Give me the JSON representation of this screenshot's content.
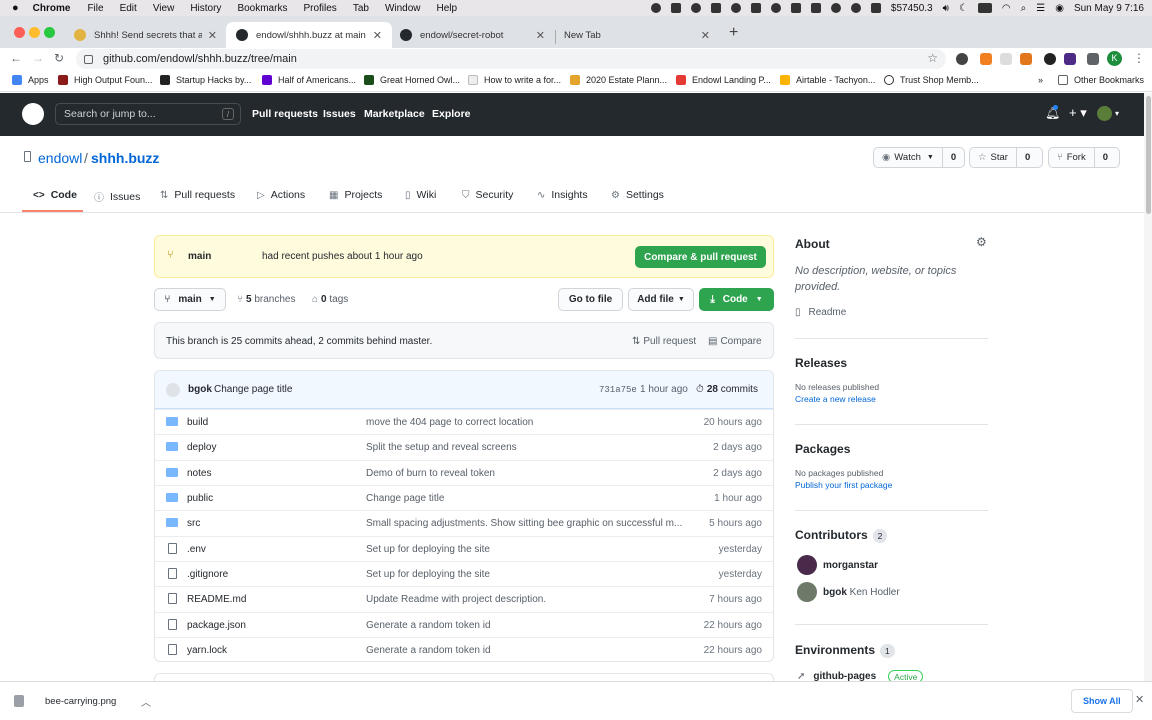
{
  "menubar": {
    "app": "Chrome",
    "items": [
      "File",
      "Edit",
      "View",
      "History",
      "Bookmarks",
      "Profiles",
      "Tab",
      "Window",
      "Help"
    ],
    "money": "$57450.3",
    "datetime": "Sun May 9  7:16"
  },
  "tabs": [
    {
      "label": "Shhh! Send secrets that autom",
      "active": false
    },
    {
      "label": "endowl/shhh.buzz at main",
      "active": true
    },
    {
      "label": "endowl/secret-robot",
      "active": false
    },
    {
      "label": "New Tab",
      "active": false
    }
  ],
  "toolbar": {
    "url": "github.com/endowl/shhh.buzz/tree/main",
    "profile": "K"
  },
  "bookmarks": {
    "items": [
      "Apps",
      "High Output Foun...",
      "Startup Hacks by...",
      "Half of Americans...",
      "Great Horned Owl...",
      "How to write a for...",
      "2020 Estate Plann...",
      "Endowl Landing P...",
      "Airtable - Tachyon...",
      "Trust Shop Memb..."
    ],
    "overflow": "»",
    "other": "Other Bookmarks"
  },
  "github_header": {
    "search_placeholder": "Search or jump to...",
    "slash": "/",
    "nav": [
      "Pull requests",
      "Issues",
      "Marketplace",
      "Explore"
    ]
  },
  "repo": {
    "owner": "endowl",
    "separator": "/",
    "name": "shhh.buzz",
    "watch": {
      "label": "Watch",
      "count": "0"
    },
    "star": {
      "label": "Star",
      "count": "0"
    },
    "fork": {
      "label": "Fork",
      "count": "0"
    }
  },
  "repo_tabs": [
    {
      "label": "Code",
      "icon": "<>"
    },
    {
      "label": "Issues",
      "icon": "ⓘ"
    },
    {
      "label": "Pull requests",
      "icon": "⇅"
    },
    {
      "label": "Actions",
      "icon": "▷"
    },
    {
      "label": "Projects",
      "icon": "▦"
    },
    {
      "label": "Wiki",
      "icon": "▯"
    },
    {
      "label": "Security",
      "icon": "⛉"
    },
    {
      "label": "Insights",
      "icon": "∿"
    },
    {
      "label": "Settings",
      "icon": "⚙"
    }
  ],
  "flash": {
    "branch": "main",
    "text": "had recent pushes about 1 hour ago",
    "button": "Compare & pull request"
  },
  "branchbar": {
    "branch": "main",
    "branches_count": "5",
    "branches_label": "branches",
    "tags_count": "0",
    "tags_label": "tags",
    "goto_file": "Go to file",
    "add_file": "Add file",
    "code": "Code"
  },
  "ahead": {
    "text": "This branch is 25 commits ahead, 2 commits behind master.",
    "pull_request": "Pull request",
    "compare": "Compare"
  },
  "commit": {
    "author": "bgok",
    "message": "Change page title",
    "sha": "731a75e",
    "age": "1 hour ago",
    "count": "28",
    "count_label": "commits"
  },
  "files": [
    {
      "type": "folder",
      "name": "build",
      "message": "move the 404 page to correct location",
      "age": "20 hours ago"
    },
    {
      "type": "folder",
      "name": "deploy",
      "message": "Split the setup and reveal screens",
      "age": "2 days ago"
    },
    {
      "type": "folder",
      "name": "notes",
      "message": "Demo of burn to reveal token",
      "age": "2 days ago"
    },
    {
      "type": "folder",
      "name": "public",
      "message": "Change page title",
      "age": "1 hour ago"
    },
    {
      "type": "folder",
      "name": "src",
      "message": "Small spacing adjustments. Show sitting bee graphic on successful m...",
      "age": "5 hours ago"
    },
    {
      "type": "file",
      "name": ".env",
      "message": "Set up for deploying the site",
      "age": "yesterday"
    },
    {
      "type": "file",
      "name": ".gitignore",
      "message": "Set up for deploying the site",
      "age": "yesterday"
    },
    {
      "type": "file",
      "name": "README.md",
      "message": "Update Readme with project description.",
      "age": "7 hours ago"
    },
    {
      "type": "file",
      "name": "package.json",
      "message": "Generate a random token id",
      "age": "22 hours ago"
    },
    {
      "type": "file",
      "name": "yarn.lock",
      "message": "Generate a random token id",
      "age": "22 hours ago"
    }
  ],
  "sidebar": {
    "about_title": "About",
    "about_text": "No description, website, or topics provided.",
    "readme": "Readme",
    "releases_title": "Releases",
    "releases_text": "No releases published",
    "releases_link": "Create a new release",
    "packages_title": "Packages",
    "packages_text": "No packages published",
    "packages_link": "Publish your first package",
    "contributors_title": "Contributors",
    "contributors_count": "2",
    "contributors": [
      {
        "login": "morganstar",
        "name": ""
      },
      {
        "login": "bgok",
        "name": "Ken Hodler"
      }
    ],
    "environments_title": "Environments",
    "environments_count": "1",
    "environment": {
      "name": "github-pages",
      "status": "Active"
    }
  },
  "downloads": {
    "file": "bee-carrying.png",
    "show_all": "Show All"
  }
}
